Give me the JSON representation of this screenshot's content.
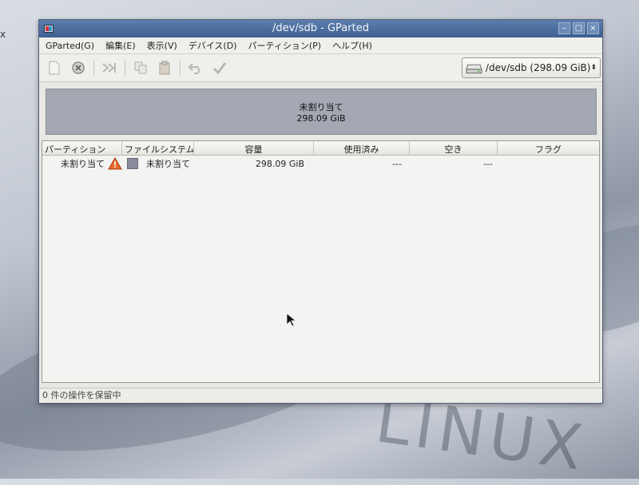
{
  "desktop": {
    "corner_glyph": "x",
    "logo_text": "LINUX"
  },
  "window": {
    "title": "/dev/sdb - GParted",
    "icons": {
      "app": "gparted-icon",
      "minimize": "minimize-icon",
      "maximize": "maximize-icon",
      "close": "close-icon"
    }
  },
  "menubar": {
    "items": [
      {
        "label": "GParted(G)"
      },
      {
        "label": "編集(E)"
      },
      {
        "label": "表示(V)"
      },
      {
        "label": "デバイス(D)"
      },
      {
        "label": "パーティション(P)"
      },
      {
        "label": "ヘルプ(H)"
      }
    ]
  },
  "toolbar": {
    "buttons": [
      "new-icon",
      "delete-icon",
      "resize-move-icon",
      "copy-icon",
      "paste-icon",
      "undo-icon",
      "apply-icon"
    ],
    "device": {
      "label": "/dev/sdb  (298.09 GiB)",
      "icon": "harddisk-icon"
    }
  },
  "diskmap": {
    "name": "未割り当て",
    "size": "298.09 GiB",
    "color": "#a4a8b2"
  },
  "table": {
    "headers": [
      "パーティション",
      "ファイルシステム",
      "容量",
      "使用済み",
      "空き",
      "フラグ"
    ],
    "rows": [
      {
        "partition": "未割り当て",
        "filesystem": "未割り当て",
        "size": "298.09 GiB",
        "used": "---",
        "free": "---",
        "flags": "",
        "status_icon": "warning-icon",
        "fs_color": "#8a8a9e"
      }
    ]
  },
  "statusbar": {
    "text": "0 件の操作を保留中"
  }
}
